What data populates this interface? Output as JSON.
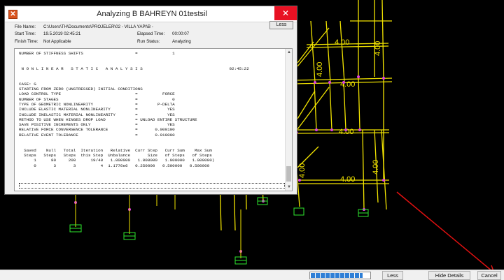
{
  "dialog": {
    "title": "Analyzing B BAHREYN 01testsil",
    "close_glyph": "✕",
    "less_label": "Less",
    "file_name_label": "File Name:",
    "file_name_value": "C:\\Users\\TH\\Documents\\PROJELER\\02 - VILLA YAPI\\B -",
    "start_time_label": "Start Time:",
    "start_time_value": "19.5.2019 02:45:21",
    "finish_time_label": "Finish Time:",
    "finish_time_value": "Not Applicable",
    "elapsed_label": "Elapsed Time:",
    "elapsed_value": "00:00:07",
    "run_status_label": "Run Status:",
    "run_status_value": "Analyzing"
  },
  "log": {
    "lines": [
      "NUMBER OF STIFFNESS SHIFTS                     =              1",
      "",
      "",
      " N O N L I N E A R   S T A T I C   A N A L Y S I S                                   02:45:22",
      "",
      "",
      "CASE: G",
      "STARTING FROM ZERO (UNSTRESSED) INITIAL CONDITIONS",
      "LOAD CONTROL TYPE                              =          FORCE",
      "NUMBER OF STAGES                               =              0",
      "TYPE OF GEOMETRIC NONLINEARITY                 =        P-DELTA",
      "INCLUDE ELASTIC MATERIAL NONLINEARITY          =            YES",
      "INCLUDE INELASTIC MATERIAL NONLINEARITY        =            YES",
      "METHOD TO USE WHEN HINGES DROP LOAD            = UNLOAD ENTIRE STRUCTURE",
      "SAVE POSITIVE INCREMENTS ONLY                  =            YES",
      "RELATIVE FORCE CONVERGENCE TOLERANCE           =       0.000100",
      "RELATIVE EVENT TOLERANCE                       =       0.010000",
      "",
      "",
      "  Saved    Null   Total  Iteration   Relative  Curr Step   Curr Sum    Max Sum",
      "  Steps   Steps   Steps  this Step  Unbalance       Size   of Steps   of Steps",
      "      1      80     200      19/40   1.000000   1.000000   1.000000   1.000000)",
      "      0       3       3          4  1.1776e6   0.250000   0.500000   0.500000"
    ]
  },
  "statusbar": {
    "less_label": "Less",
    "hide_details_label": "Hide Details",
    "cancel_label": "Cancel",
    "progress_fraction": 0.88
  },
  "drawing": {
    "dimension_label": "4.00",
    "line_color": "#f2e400",
    "node_color": "#e040e0",
    "support_color": "#2ee82e",
    "arrow_color": "#e01010"
  }
}
